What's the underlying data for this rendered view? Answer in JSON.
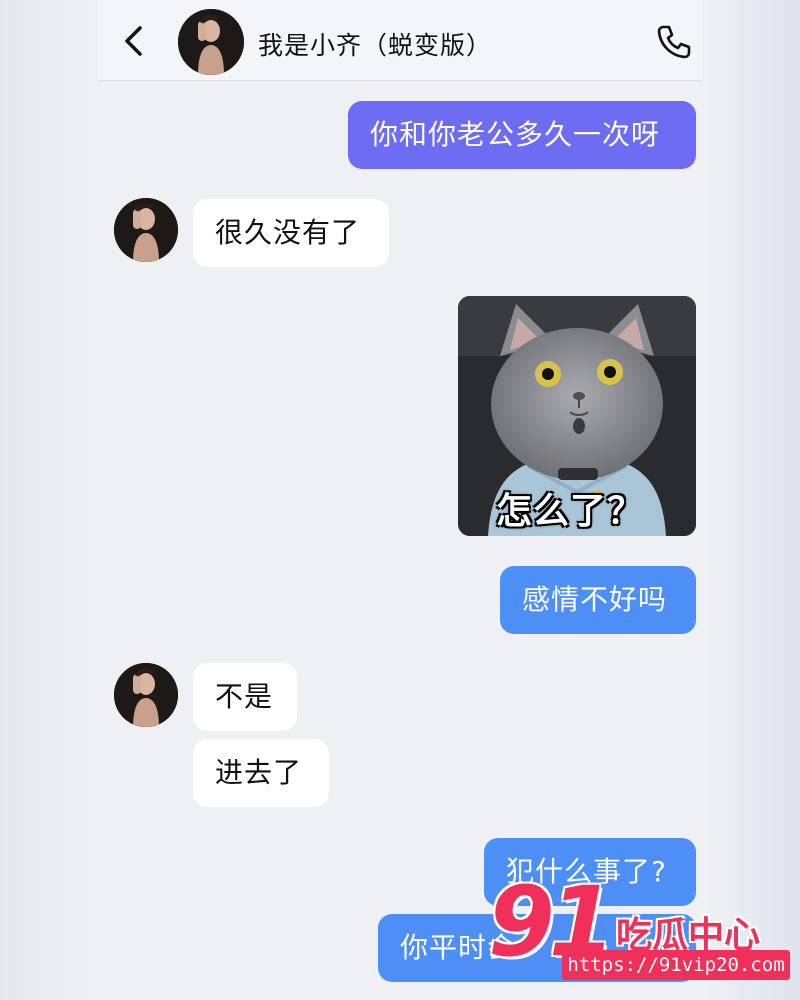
{
  "header": {
    "title": "我是小齐（蜕变版）",
    "back_icon": "chevron-left-icon",
    "call_icon": "phone-icon"
  },
  "messages": [
    {
      "side": "out",
      "text": "你和你老公多久一次呀",
      "color": "#6d6cf2"
    },
    {
      "side": "in",
      "text": "很久没有了"
    },
    {
      "side": "out",
      "type": "sticker",
      "caption": "怎么了？"
    },
    {
      "side": "out",
      "text": "感情不好吗",
      "color": "#4e8ff7"
    },
    {
      "side": "in",
      "text": "不是"
    },
    {
      "side": "in",
      "text": "进去了"
    },
    {
      "side": "out",
      "text": "犯什么事了?",
      "color": "#4e8ff7"
    },
    {
      "side": "out",
      "text": "你平时会",
      "color": "#4e8ff7"
    }
  ],
  "watermark": {
    "number": "91",
    "name": "吃瓜中心",
    "url": "https://91vip20.com",
    "color": "#f0305a"
  },
  "colors": {
    "chat_background": "#eff0f4",
    "bubble_in": "#ffffff",
    "bubble_out_purple": "#6d6cf2",
    "bubble_out_blue": "#4e8ff7"
  }
}
